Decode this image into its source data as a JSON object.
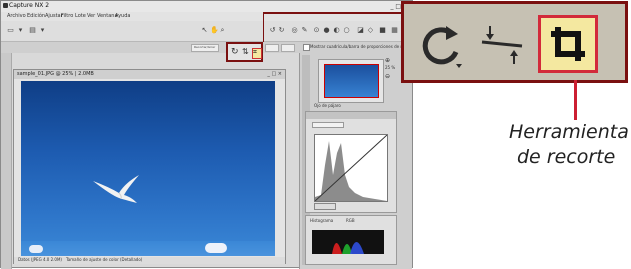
{
  "window": {
    "title": "Capture NX 2",
    "menus": [
      "Archivo",
      "Edición",
      "Ajustar",
      "Filtro",
      "Lote",
      "Ver",
      "Ventana",
      "Ayuda"
    ]
  },
  "toolbar": {
    "options_label": "Recortar/Girar",
    "checkbox_label": "Mostrar cuadrícula/barra de proporciones de recorte"
  },
  "document": {
    "title": "sample_01.JPG @ 25% | 2.0MB",
    "status_left": "Datos (JPEG 4.0 2.0M)",
    "status_right": "Tamaño de ajuste de color (Detallado)"
  },
  "panels": {
    "birdseye_title": "Ojo de pájaro",
    "zoom": "25 %",
    "levels_title": "Niveles y curvas",
    "ajuste_title": "Ajuste rápido",
    "histogram_title": "Histograma",
    "rgb_title": "RGB"
  },
  "callout": {
    "caption_line1": "Herramienta",
    "caption_line2": "de recorte"
  },
  "colors": {
    "callout_border": "#7a1010",
    "highlight_red": "#d22a3a",
    "sky_blue": "#1d5bb0"
  }
}
